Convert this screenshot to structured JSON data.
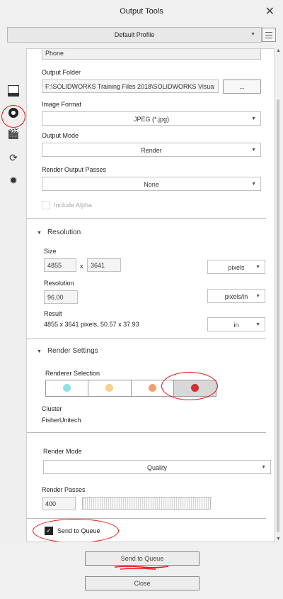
{
  "window": {
    "title": "Output Tools"
  },
  "profile": {
    "value": "Default Profile"
  },
  "output": {
    "device_value": "Phone",
    "folder_label": "Output Folder",
    "folder_value": "F:\\SOLIDWORKS Training Files 2018\\SOLIDWORKS Visua",
    "browse_label": "...",
    "format_label": "Image Format",
    "format_value": "JPEG (*.jpg)",
    "mode_label": "Output Mode",
    "mode_value": "Render",
    "passes_label": "Render Output Passes",
    "passes_value": "None",
    "alpha_label": "Include Alpha"
  },
  "resolution": {
    "heading": "Resolution",
    "size_label": "Size",
    "width": "4855",
    "x_sep": "x",
    "height": "3641",
    "size_unit": "pixels",
    "res_label": "Resolution",
    "res_value": "96.00",
    "res_unit": "pixels/in",
    "result_label": "Result",
    "result_value": "4855 x 3641 pixels, 50.57 x 37.93",
    "result_unit": "in"
  },
  "render_settings": {
    "heading": "Render Settings",
    "renderer_label": "Renderer Selection",
    "renderer_colors": [
      "#8fe3e6",
      "#f5d28a",
      "#f0a070",
      "#d03030"
    ],
    "selected_renderer_index": 3,
    "cluster_label": "Cluster",
    "cluster_value": "FisherUnitech",
    "mode_label": "Render Mode",
    "mode_value": "Quality",
    "passes_label": "Render Passes",
    "passes_value": "400",
    "queue_checkbox_label": "Send to Queue",
    "queue_checked": true
  },
  "footer": {
    "send_button": "Send to Queue",
    "close_button": "Close"
  },
  "annotation_color": "#e11111"
}
